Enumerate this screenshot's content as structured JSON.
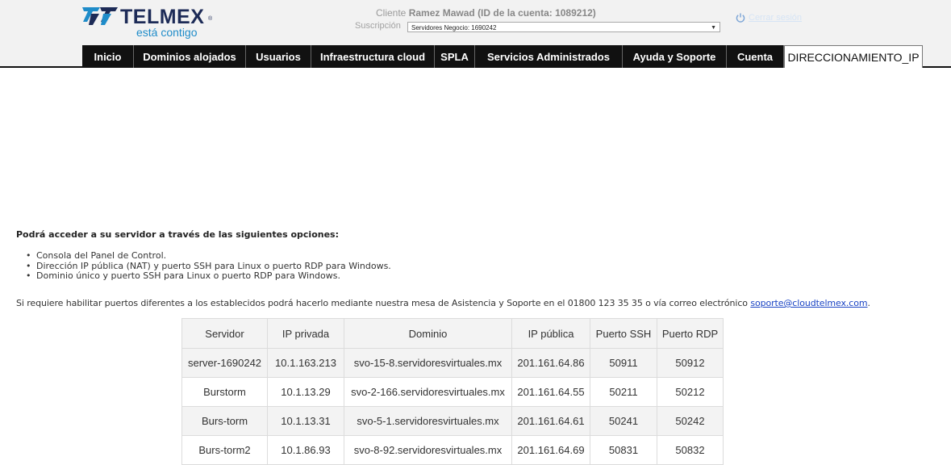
{
  "header": {
    "brand": "TELMEX",
    "tagline": "está contigo",
    "client_label": "Cliente",
    "client_value": "Ramez Mawad (ID de la cuenta: 1089212)",
    "subscription_label": "Suscripción",
    "subscription_value": "Servidores Negocio: 1690242",
    "logout_label": "Cerrar sesión",
    "power_icon": "power-icon"
  },
  "nav": {
    "tabs": [
      {
        "label": "Inicio"
      },
      {
        "label": "Dominios alojados"
      },
      {
        "label": "Usuarios"
      },
      {
        "label": "Infraestructura cloud"
      },
      {
        "label": "SPLA"
      },
      {
        "label": "Servicios Administrados"
      },
      {
        "label": "Ayuda y Soporte"
      },
      {
        "label": "Cuenta"
      },
      {
        "label": "DIRECCIONAMIENTO_IP"
      }
    ],
    "active": "DIRECCIONAMIENTO_IP"
  },
  "content": {
    "intro": "Podrá acceder a su servidor a través de las siguientes opciones:",
    "options": [
      "Consola del Panel de Control.",
      "Dirección IP pública (NAT) y puerto SSH para Linux o puerto RDP para Windows.",
      "Dominio único y puerto SSH para Linux o puerto RDP para Windows."
    ],
    "note": "Si requiere habilitar puertos diferentes a los establecidos podrá hacerlo mediante nuestra mesa de Asistencia y Soporte en el 01800 123 35 35 o vía correo electrónico",
    "note_email": "soporte@cloudtelmex.com",
    "note_end": "."
  },
  "table": {
    "columns": [
      "Servidor",
      "IP privada",
      "Dominio",
      "IP pública",
      "Puerto SSH",
      "Puerto RDP"
    ],
    "rows": [
      [
        "server-1690242",
        "10.1.163.213",
        "svo-15-8.servidoresvirtuales.mx",
        "201.161.64.86",
        "50911",
        "50912"
      ],
      [
        "Burstorm",
        "10.1.13.29",
        "svo-2-166.servidoresvirtuales.mx",
        "201.161.64.55",
        "50211",
        "50212"
      ],
      [
        "Burs-torm",
        "10.1.13.31",
        "svo-5-1.servidoresvirtuales.mx",
        "201.161.64.61",
        "50241",
        "50242"
      ],
      [
        "Burs-torm2",
        "10.1.86.93",
        "svo-8-92.servidoresvirtuales.mx",
        "201.161.64.69",
        "50831",
        "50832"
      ]
    ]
  },
  "colors": {
    "nav_bg": "#111111",
    "brand_navy": "#1d2b57",
    "brand_blue": "#1f8cc9",
    "link": "#1a44c4"
  }
}
